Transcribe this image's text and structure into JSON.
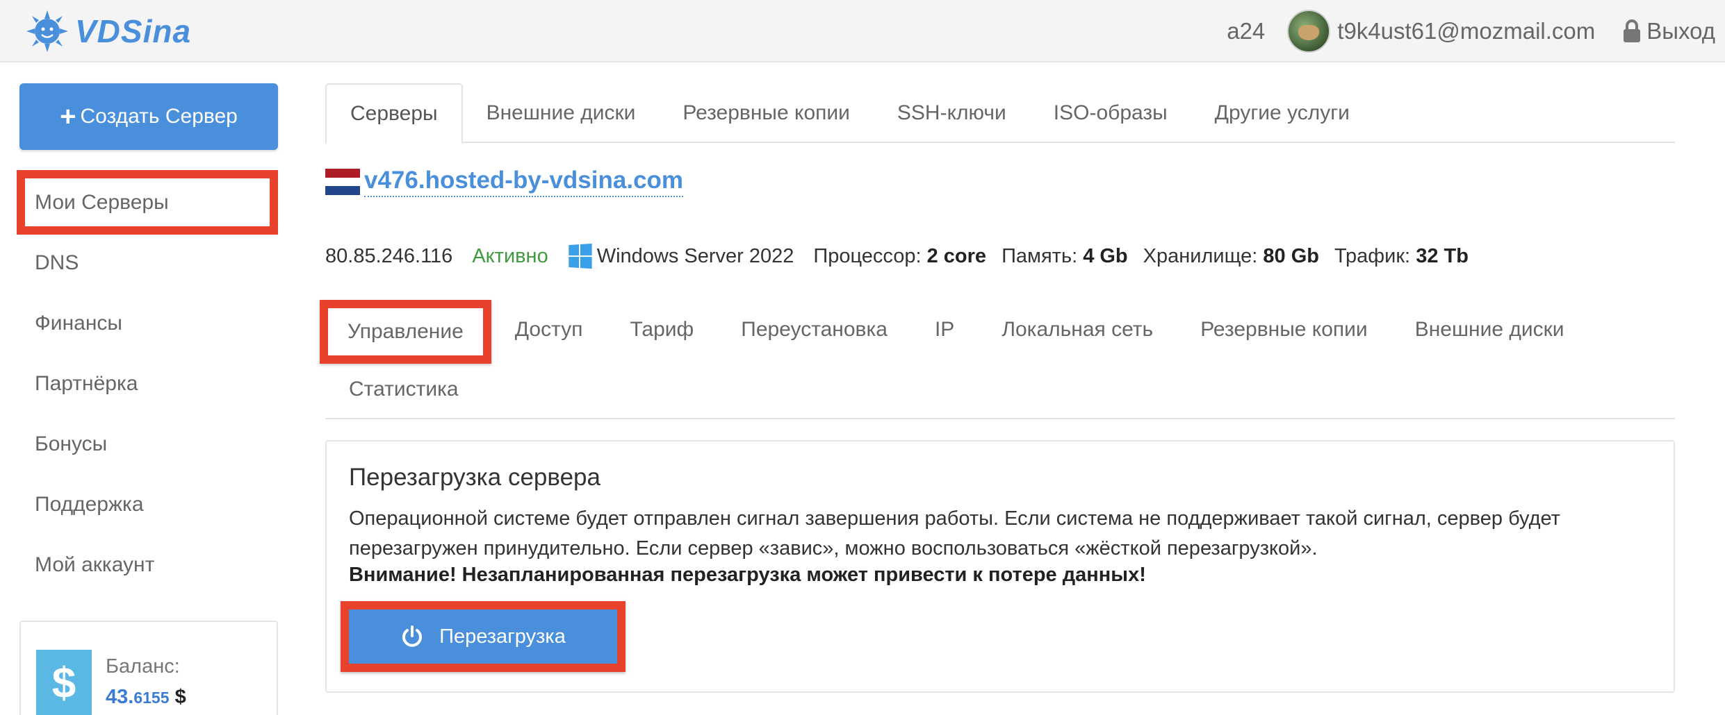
{
  "header": {
    "logo_text": "VDSina",
    "login": "a24",
    "email": "t9k4ust61@mozmail.com",
    "logout_label": "Выход"
  },
  "sidebar": {
    "create_button_label": "Создать Сервер",
    "items": [
      {
        "label": "Мои Серверы",
        "active": true
      },
      {
        "label": "DNS"
      },
      {
        "label": "Финансы"
      },
      {
        "label": "Партнёрка"
      },
      {
        "label": "Бонусы"
      },
      {
        "label": "Поддержка"
      },
      {
        "label": "Мой аккаунт"
      }
    ],
    "balance": {
      "label": "Баланс:",
      "integer": "43.",
      "fraction": "6155",
      "currency": "$"
    }
  },
  "top_tabs": [
    "Серверы",
    "Внешние диски",
    "Резервные копии",
    "SSH-ключи",
    "ISO-образы",
    "Другие услуги"
  ],
  "server": {
    "hostname": "v476.hosted-by-vdsina.com",
    "ip": "80.85.246.116",
    "status": "Активно",
    "os": "Windows Server 2022",
    "specs": {
      "cpu_label": "Процессор:",
      "cpu_value": "2 core",
      "ram_label": "Память:",
      "ram_value": "4 Gb",
      "disk_label": "Хранилище:",
      "disk_value": "80 Gb",
      "traffic_label": "Трафик:",
      "traffic_value": "32 Tb"
    }
  },
  "sub_tabs": [
    "Управление",
    "Доступ",
    "Тариф",
    "Переустановка",
    "IP",
    "Локальная сеть",
    "Резервные копии",
    "Внешние диски",
    "Статистика"
  ],
  "panel": {
    "title": "Перезагрузка сервера",
    "description": "Операционной системе будет отправлен сигнал завершения работы. Если система не поддерживает такой сигнал, сервер будет перезагружен принудительно. Если сервер «завис», можно воспользоваться «жёсткой перезагрузкой».",
    "warning": "Внимание! Незапланированная перезагрузка может привести к потере данных!",
    "button_label": "Перезагрузка"
  },
  "colors": {
    "accent": "#4a8fdb",
    "highlight": "#e8412c",
    "status_active": "#3f9a3f",
    "balance_icon": "#5bb8e5"
  },
  "icons": [
    "logo-sun-icon",
    "lock-icon",
    "plus-icon",
    "netherlands-flag-icon",
    "windows-icon",
    "dollar-icon",
    "power-icon"
  ]
}
